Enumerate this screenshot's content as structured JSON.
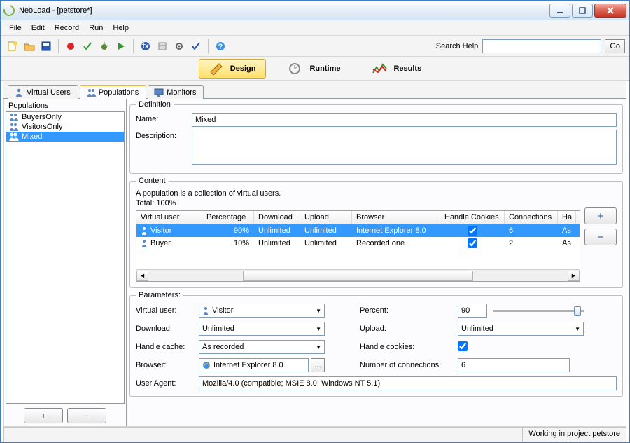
{
  "window": {
    "title": "NeoLoad - [petstore*]"
  },
  "menu": {
    "file": "File",
    "edit": "Edit",
    "record": "Record",
    "run": "Run",
    "help": "Help"
  },
  "search": {
    "label": "Search Help",
    "value": "",
    "go": "Go"
  },
  "navtabs": {
    "design": "Design",
    "runtime": "Runtime",
    "results": "Results",
    "active": "design"
  },
  "subtabs": {
    "virtual_users": "Virtual Users",
    "populations": "Populations",
    "monitors": "Monitors",
    "active": "populations"
  },
  "populations": {
    "title": "Populations",
    "items": [
      "BuyersOnly",
      "VisitorsOnly",
      "Mixed"
    ],
    "selected": 2
  },
  "definition": {
    "legend": "Definition",
    "name_label": "Name:",
    "name_value": "Mixed",
    "desc_label": "Description:",
    "desc_value": ""
  },
  "content": {
    "legend": "Content",
    "hint": "A population is a collection of virtual users.",
    "total": "Total: 100%",
    "headers": [
      "Virtual user",
      "Percentage",
      "Download",
      "Upload",
      "Browser",
      "Handle Cookies",
      "Connections",
      "Ha"
    ],
    "rows": [
      {
        "vu": "Visitor",
        "pct": "90%",
        "dl": "Unlimited",
        "ul": "Unlimited",
        "br": "Internet Explorer 8.0",
        "hc": true,
        "cn": "6",
        "last": "As"
      },
      {
        "vu": "Buyer",
        "pct": "10%",
        "dl": "Unlimited",
        "ul": "Unlimited",
        "br": "Recorded one",
        "hc": true,
        "cn": "2",
        "last": "As"
      }
    ],
    "selected_row": 0
  },
  "parameters": {
    "legend": "Parameters:",
    "virtual_user_label": "Virtual user:",
    "virtual_user_value": "Visitor",
    "percent_label": "Percent:",
    "percent_value": "90",
    "download_label": "Download:",
    "download_value": "Unlimited",
    "upload_label": "Upload:",
    "upload_value": "Unlimited",
    "handle_cache_label": "Handle cache:",
    "handle_cache_value": "As recorded",
    "handle_cookies_label": "Handle cookies:",
    "handle_cookies_value": true,
    "browser_label": "Browser:",
    "browser_value": "Internet Explorer 8.0",
    "connections_label": "Number of connections:",
    "connections_value": "6",
    "user_agent_label": "User Agent:",
    "user_agent_value": "Mozilla/4.0 (compatible; MSIE 8.0; Windows NT 5.1)"
  },
  "statusbar": {
    "text": "Working in project petstore"
  }
}
